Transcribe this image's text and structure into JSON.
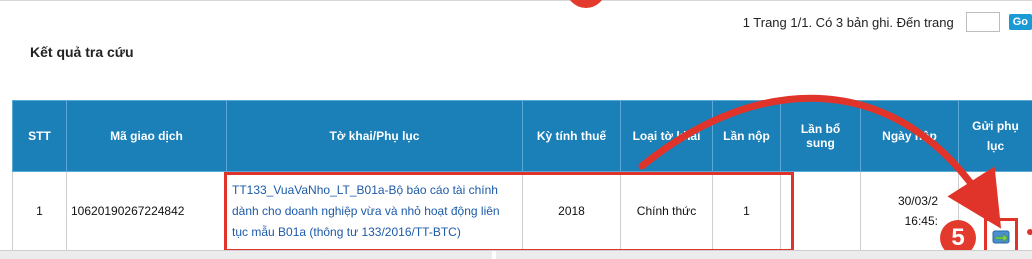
{
  "pager": {
    "text": "1  Trang 1/1. Có 3 bản ghi. Đến trang",
    "go_label": "Go"
  },
  "result_title": "Kết quả tra cứu",
  "table": {
    "headers": [
      "STT",
      "Mã giao dịch",
      "Tờ khai/Phụ lục",
      "Kỳ tính thuế",
      "Loại tờ khai",
      "Lần nộp",
      "Lần bổ sung",
      "Ngày nộp",
      "Gửi phụ lục"
    ],
    "rows": [
      {
        "stt": "1",
        "ma_giao_dich": "10620190267224842",
        "to_khai": "TT133_VuaVaNho_LT_B01a-Bộ báo cáo tài chính dành cho doanh nghiệp vừa và nhỏ hoạt động liên tục mẫu B01a (thông tư 133/2016/TT-BTC)",
        "ky_tinh_thue": "2018",
        "loai_to_khai": "Chính thức",
        "lan_nop": "1",
        "lan_bo_sung": "",
        "ngay_nop_date": "30/03/2",
        "ngay_nop_time": "16:45:"
      }
    ]
  },
  "annotation": {
    "step_number": "5",
    "accent_color": "#e0342a"
  },
  "icons": {
    "send": "send-appendix-icon"
  }
}
